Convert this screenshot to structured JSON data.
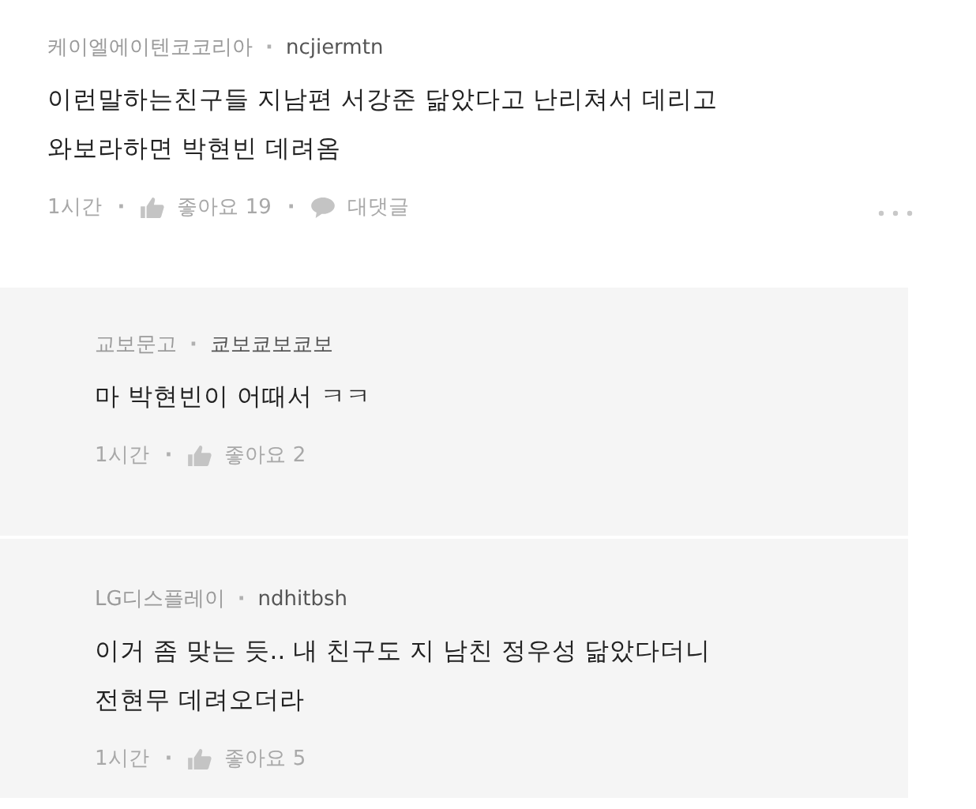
{
  "comment": {
    "company": "케이엘에이텐코코리아",
    "sep_1": "·",
    "user": "ncjiermtn",
    "text": "이런말하는친구들 지남편 서강준 닮았다고 난리쳐서 데리고 와보라하면 박현빈 데려옴",
    "time": "1시간",
    "sep_2": "·",
    "likes": "좋아요 19",
    "sep_3": "·",
    "reply_label": "대댓글"
  },
  "replies": [
    {
      "company": "교보문고",
      "sep_1": "·",
      "user": "쿄보쿄보쿄보",
      "text": "마 박현빈이 어때서 ㅋㅋ",
      "time": "1시간",
      "sep_2": "·",
      "likes": "좋아요 2"
    },
    {
      "company": "LG디스플레이",
      "sep_1": "·",
      "user": "ndhitbsh",
      "text": "이거 좀 맞는 듯.. 내 친구도 지 남친 정우성 닮았다더니 전현무 데려오더라",
      "time": "1시간",
      "sep_2": "·",
      "likes": "좋아요 5"
    }
  ]
}
